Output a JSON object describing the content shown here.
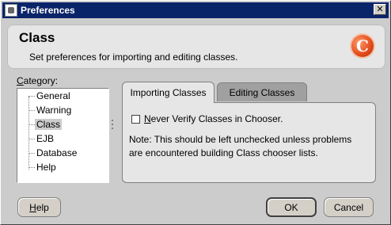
{
  "window": {
    "title": "Preferences",
    "close_glyph": "✕"
  },
  "header": {
    "title": "Class",
    "subtitle": "Set preferences for importing and editing classes.",
    "logo_glyph": "C"
  },
  "category": {
    "label_prefix": "C",
    "label_rest": "ategory:",
    "items": [
      {
        "label": "General",
        "selected": false
      },
      {
        "label": "Warning",
        "selected": false
      },
      {
        "label": "Class",
        "selected": true
      },
      {
        "label": "EJB",
        "selected": false
      },
      {
        "label": "Database",
        "selected": false
      },
      {
        "label": "Help",
        "selected": false
      }
    ]
  },
  "tabs": [
    {
      "label": "Importing Classes",
      "active": true
    },
    {
      "label": "Editing Classes",
      "active": false
    }
  ],
  "importing": {
    "checkbox_mnemonic": "N",
    "checkbox_rest": "ever Verify Classes in Chooser.",
    "checkbox_checked": false,
    "note_line1": "Note: This should be left unchecked unless problems",
    "note_line2": "are encountered building Class chooser lists."
  },
  "buttons": {
    "help_mnemonic": "H",
    "help_rest": "elp",
    "ok": "OK",
    "cancel": "Cancel"
  }
}
